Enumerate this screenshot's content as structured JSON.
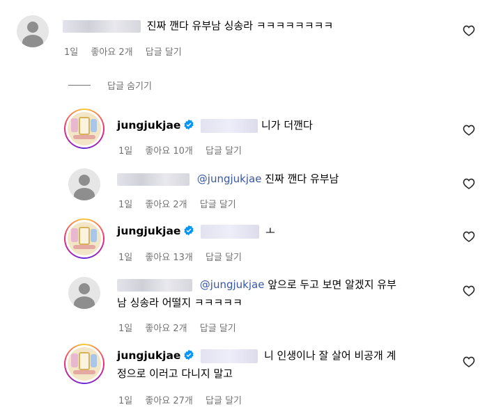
{
  "top_comment": {
    "text": "진짜 깬다 유부남 싱송라 ㅋㅋㅋㅋㅋㅋㅋㅋ",
    "time": "1일",
    "likes": "좋아요 2개",
    "reply": "답글 달기"
  },
  "hide_replies_label": "답글 숨기기",
  "replies": [
    {
      "author": "jungjukjae",
      "text": "니가 더깬다",
      "time": "1일",
      "likes": "좋아요 10개",
      "reply": "답글 달기"
    },
    {
      "mention": "@jungjukjae",
      "text": "진짜 깬다 유부남",
      "time": "1일",
      "likes": "좋아요 2개",
      "reply": "답글 달기"
    },
    {
      "author": "jungjukjae",
      "text": "ㅗ",
      "time": "1일",
      "likes": "좋아요 13개",
      "reply": "답글 달기"
    },
    {
      "mention": "@jungjukjae",
      "text_line1": "앞으로 두고 보면 알겠지 유부",
      "text_line2": "남 싱송라 어떨지 ㅋㅋㅋㅋㅋ",
      "time": "1일",
      "likes": "좋아요 2개",
      "reply": "답글 달기"
    },
    {
      "author": "jungjukjae",
      "text_line1": "니 인생이나 잘 살어 비공개 계",
      "text_line2": "정으로 이러고 다니지 말고",
      "time": "1일",
      "likes": "좋아요 27개",
      "reply": "답글 달기"
    }
  ],
  "icons": {
    "heart": "heart-outline-icon",
    "verified": "verified-badge-icon",
    "avatar": "default-avatar-icon"
  },
  "colors": {
    "mention": "#3a56a6",
    "meta": "#737373",
    "verified": "#0095f6"
  }
}
